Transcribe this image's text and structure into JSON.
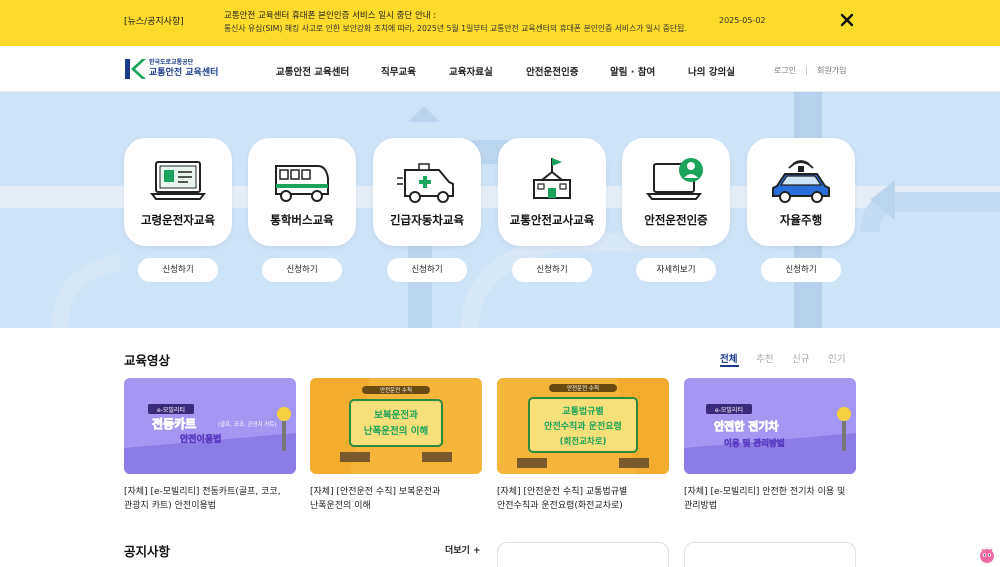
{
  "notice": {
    "tag": "[뉴스/공지사항]",
    "line1": "교통안전 교육센터 휴대폰 본인인증 서비스 일시 중단 안내 :",
    "line2": "통신사 유심(SIM) 해킹 사고로 인한 보안강화 조치에 따라, 2025년 5월 1일부터 교통안전 교육센터의 휴대폰 본인인증 서비스가 일시 중단됩...",
    "date": "2025-05-02",
    "close_icon": "close-icon"
  },
  "header": {
    "logo_top": "한국도로교통공단",
    "logo_bottom": "교통안전 교육센터",
    "nav": [
      "교통안전 교육센터",
      "직무교육",
      "교육자료실",
      "안전운전인증",
      "알림 · 참여",
      "나의 강의실"
    ],
    "login": "로그인",
    "join": "회원가입"
  },
  "hero": {
    "cards": [
      {
        "title": "고령운전자교육",
        "button": "신청하기",
        "icon": "monitor-id-icon"
      },
      {
        "title": "통학버스교육",
        "button": "신청하기",
        "icon": "school-bus-icon"
      },
      {
        "title": "긴급자동차교육",
        "button": "신청하기",
        "icon": "ambulance-icon"
      },
      {
        "title": "교통안전교사교육",
        "button": "신청하기",
        "icon": "school-building-icon"
      },
      {
        "title": "안전운전인증",
        "button": "자세히보기",
        "icon": "laptop-user-icon"
      },
      {
        "title": "자율주행",
        "button": "신청하기",
        "icon": "autonomous-car-icon"
      }
    ]
  },
  "videos": {
    "title": "교육영상",
    "tabs": [
      "전체",
      "추천",
      "신규",
      "인기"
    ],
    "active_tab": "전체",
    "items": [
      {
        "line1": "[자체] [e-모빌리티] 전동카트(골프, 코코,",
        "line2": "관광지 카트) 안전이용법",
        "thumb_main": "전동카트",
        "thumb_sub": "안전이용법",
        "thumb_note": "(골프, 코코, 관광지 카트)",
        "thumb_tag": "e-모빌리티"
      },
      {
        "line1": "[자체] [안전운전 수칙] 보복운전과",
        "line2": "난폭운전의 이해",
        "thumb_main": "보복운전과",
        "thumb_sub": "난폭운전의 이해",
        "thumb_note": "",
        "thumb_tag": "안전운전 수칙"
      },
      {
        "line1": "[자체] [안전운전 수칙] 교통법규별",
        "line2": "안전수칙과 운전요령(화전교차로)",
        "thumb_main": "교통법규별",
        "thumb_sub": "안전수칙과 운전요령",
        "thumb_note": "(회전교차로)",
        "thumb_tag": "안전운전 수칙"
      },
      {
        "line1": "[자체] [e-모빌리티] 안전한 전기차 이용 및",
        "line2": "관리방법",
        "thumb_main": "안전한 전기차",
        "thumb_sub": "이용 및 관리방법",
        "thumb_note": "",
        "thumb_tag": "e-모빌리티"
      }
    ]
  },
  "notices": {
    "title": "공지사항",
    "more": "더보기 +"
  },
  "colors": {
    "notice_bg": "#fddb2a",
    "brand": "#1a3a8a",
    "hero_bg": "#cfe3f7",
    "green": "#1aa35a",
    "purple": "#9b8ef0",
    "orange": "#f4b53a"
  }
}
